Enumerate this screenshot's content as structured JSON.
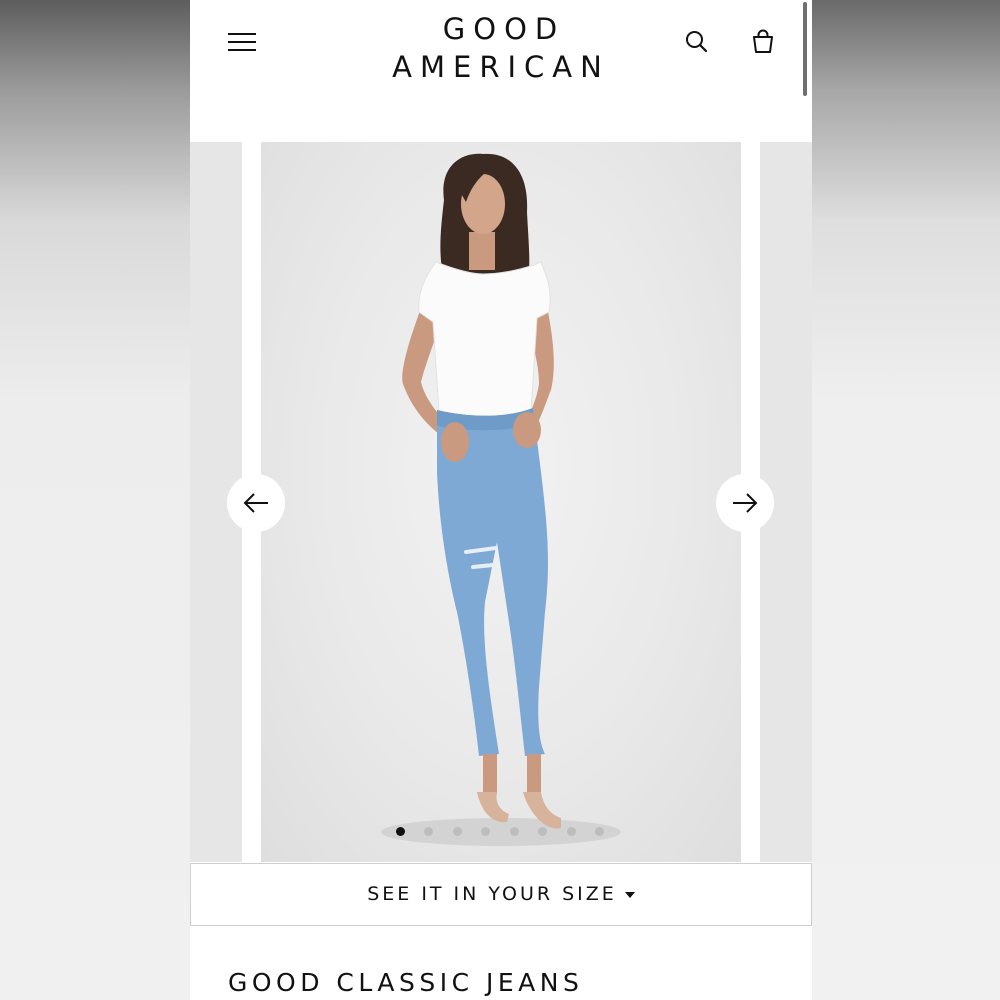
{
  "brand": {
    "line1": "GOOD",
    "line2": "AMERICAN"
  },
  "header": {
    "menu_icon": "hamburger-menu-icon",
    "search_icon": "search-icon",
    "bag_icon": "shopping-bag-icon"
  },
  "carousel": {
    "prev_icon": "arrow-left-icon",
    "next_icon": "arrow-right-icon",
    "slide_count": 8,
    "active_slide": 1,
    "model_image": "Model wearing white t-shirt and light-wash ripped skinny jeans"
  },
  "size_button": {
    "label": "SEE IT IN YOUR SIZE",
    "icon": "caret-down-icon"
  },
  "product": {
    "title": "GOOD CLASSIC JEANS"
  },
  "colors": {
    "text": "#111111",
    "background": "#ffffff",
    "dot_inactive": "#bdbdbd",
    "denim": "#7ea9d4"
  }
}
